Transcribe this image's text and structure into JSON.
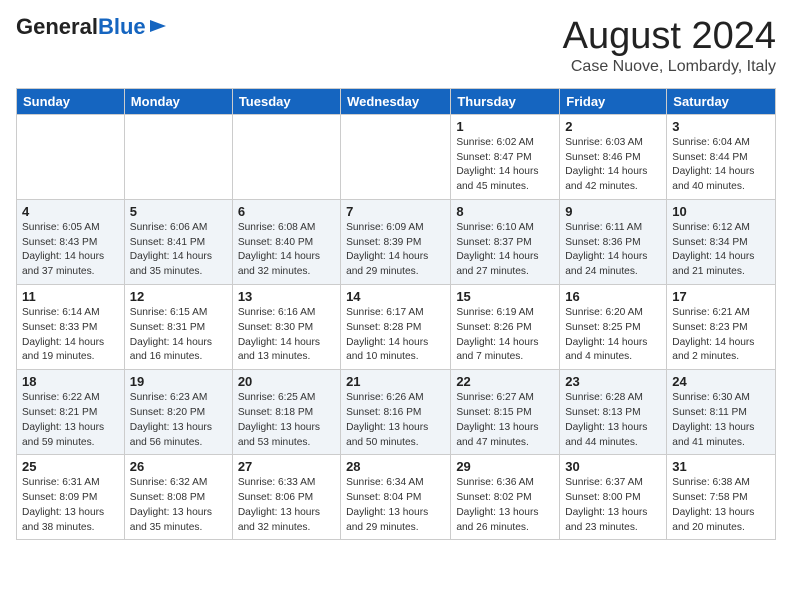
{
  "header": {
    "logo_general": "General",
    "logo_blue": "Blue",
    "month_year": "August 2024",
    "location": "Case Nuove, Lombardy, Italy"
  },
  "columns": [
    "Sunday",
    "Monday",
    "Tuesday",
    "Wednesday",
    "Thursday",
    "Friday",
    "Saturday"
  ],
  "weeks": [
    [
      {
        "day": "",
        "info": ""
      },
      {
        "day": "",
        "info": ""
      },
      {
        "day": "",
        "info": ""
      },
      {
        "day": "",
        "info": ""
      },
      {
        "day": "1",
        "info": "Sunrise: 6:02 AM\nSunset: 8:47 PM\nDaylight: 14 hours\nand 45 minutes."
      },
      {
        "day": "2",
        "info": "Sunrise: 6:03 AM\nSunset: 8:46 PM\nDaylight: 14 hours\nand 42 minutes."
      },
      {
        "day": "3",
        "info": "Sunrise: 6:04 AM\nSunset: 8:44 PM\nDaylight: 14 hours\nand 40 minutes."
      }
    ],
    [
      {
        "day": "4",
        "info": "Sunrise: 6:05 AM\nSunset: 8:43 PM\nDaylight: 14 hours\nand 37 minutes."
      },
      {
        "day": "5",
        "info": "Sunrise: 6:06 AM\nSunset: 8:41 PM\nDaylight: 14 hours\nand 35 minutes."
      },
      {
        "day": "6",
        "info": "Sunrise: 6:08 AM\nSunset: 8:40 PM\nDaylight: 14 hours\nand 32 minutes."
      },
      {
        "day": "7",
        "info": "Sunrise: 6:09 AM\nSunset: 8:39 PM\nDaylight: 14 hours\nand 29 minutes."
      },
      {
        "day": "8",
        "info": "Sunrise: 6:10 AM\nSunset: 8:37 PM\nDaylight: 14 hours\nand 27 minutes."
      },
      {
        "day": "9",
        "info": "Sunrise: 6:11 AM\nSunset: 8:36 PM\nDaylight: 14 hours\nand 24 minutes."
      },
      {
        "day": "10",
        "info": "Sunrise: 6:12 AM\nSunset: 8:34 PM\nDaylight: 14 hours\nand 21 minutes."
      }
    ],
    [
      {
        "day": "11",
        "info": "Sunrise: 6:14 AM\nSunset: 8:33 PM\nDaylight: 14 hours\nand 19 minutes."
      },
      {
        "day": "12",
        "info": "Sunrise: 6:15 AM\nSunset: 8:31 PM\nDaylight: 14 hours\nand 16 minutes."
      },
      {
        "day": "13",
        "info": "Sunrise: 6:16 AM\nSunset: 8:30 PM\nDaylight: 14 hours\nand 13 minutes."
      },
      {
        "day": "14",
        "info": "Sunrise: 6:17 AM\nSunset: 8:28 PM\nDaylight: 14 hours\nand 10 minutes."
      },
      {
        "day": "15",
        "info": "Sunrise: 6:19 AM\nSunset: 8:26 PM\nDaylight: 14 hours\nand 7 minutes."
      },
      {
        "day": "16",
        "info": "Sunrise: 6:20 AM\nSunset: 8:25 PM\nDaylight: 14 hours\nand 4 minutes."
      },
      {
        "day": "17",
        "info": "Sunrise: 6:21 AM\nSunset: 8:23 PM\nDaylight: 14 hours\nand 2 minutes."
      }
    ],
    [
      {
        "day": "18",
        "info": "Sunrise: 6:22 AM\nSunset: 8:21 PM\nDaylight: 13 hours\nand 59 minutes."
      },
      {
        "day": "19",
        "info": "Sunrise: 6:23 AM\nSunset: 8:20 PM\nDaylight: 13 hours\nand 56 minutes."
      },
      {
        "day": "20",
        "info": "Sunrise: 6:25 AM\nSunset: 8:18 PM\nDaylight: 13 hours\nand 53 minutes."
      },
      {
        "day": "21",
        "info": "Sunrise: 6:26 AM\nSunset: 8:16 PM\nDaylight: 13 hours\nand 50 minutes."
      },
      {
        "day": "22",
        "info": "Sunrise: 6:27 AM\nSunset: 8:15 PM\nDaylight: 13 hours\nand 47 minutes."
      },
      {
        "day": "23",
        "info": "Sunrise: 6:28 AM\nSunset: 8:13 PM\nDaylight: 13 hours\nand 44 minutes."
      },
      {
        "day": "24",
        "info": "Sunrise: 6:30 AM\nSunset: 8:11 PM\nDaylight: 13 hours\nand 41 minutes."
      }
    ],
    [
      {
        "day": "25",
        "info": "Sunrise: 6:31 AM\nSunset: 8:09 PM\nDaylight: 13 hours\nand 38 minutes."
      },
      {
        "day": "26",
        "info": "Sunrise: 6:32 AM\nSunset: 8:08 PM\nDaylight: 13 hours\nand 35 minutes."
      },
      {
        "day": "27",
        "info": "Sunrise: 6:33 AM\nSunset: 8:06 PM\nDaylight: 13 hours\nand 32 minutes."
      },
      {
        "day": "28",
        "info": "Sunrise: 6:34 AM\nSunset: 8:04 PM\nDaylight: 13 hours\nand 29 minutes."
      },
      {
        "day": "29",
        "info": "Sunrise: 6:36 AM\nSunset: 8:02 PM\nDaylight: 13 hours\nand 26 minutes."
      },
      {
        "day": "30",
        "info": "Sunrise: 6:37 AM\nSunset: 8:00 PM\nDaylight: 13 hours\nand 23 minutes."
      },
      {
        "day": "31",
        "info": "Sunrise: 6:38 AM\nSunset: 7:58 PM\nDaylight: 13 hours\nand 20 minutes."
      }
    ]
  ]
}
